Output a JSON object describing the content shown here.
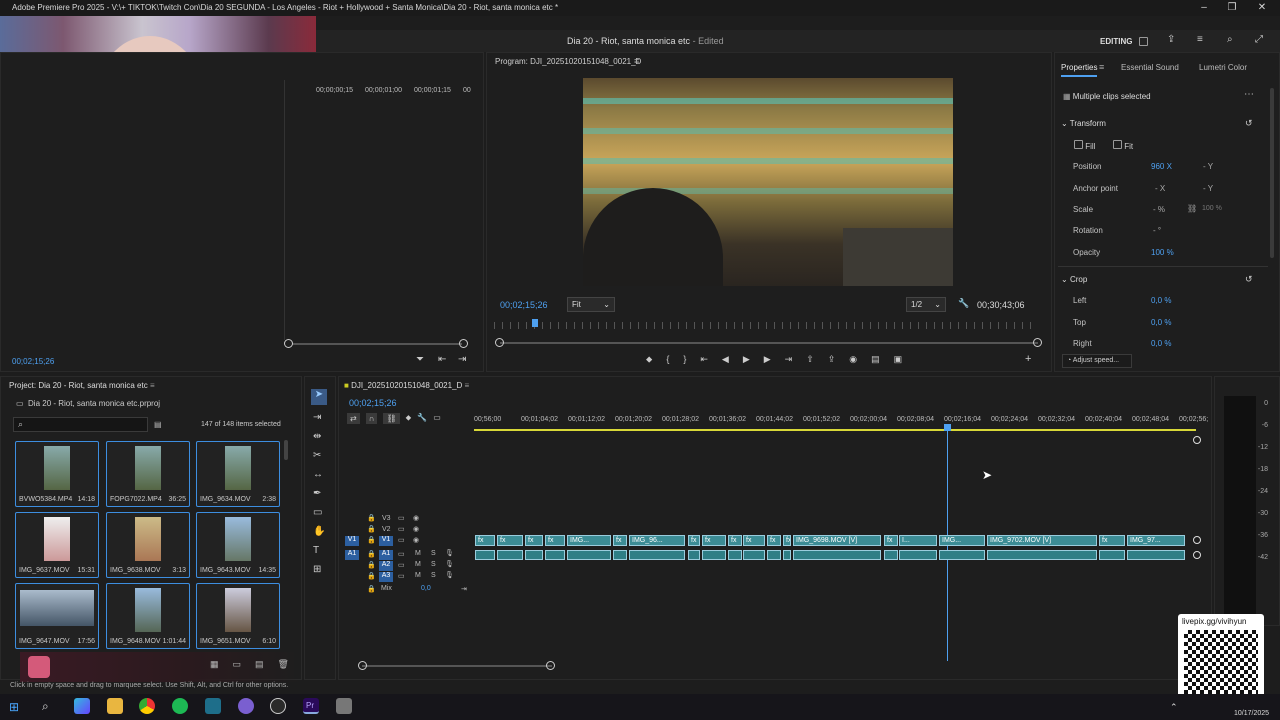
{
  "window": {
    "title": "Adobe Premiere Pro 2025 - V:\\+ TIKTOK\\Twitch Con\\Dia 20 SEGUNDA - Los Angeles - Riot + Hollywood + Santa Monica\\Dia 20 - Riot, santa monica etc *"
  },
  "header": {
    "doc_title": "Dia 20 - Riot, santa monica etc",
    "doc_status": "- Edited",
    "workspace": "EDITING"
  },
  "source": {
    "timecode": "00;02;15;26",
    "ruler": [
      "00;00;00;15",
      "00;00;01;00",
      "00;00;01;15",
      "00"
    ]
  },
  "program": {
    "label": "Program: DJI_20251020151048_0021_D",
    "timecode": "00;02;15;26",
    "fit": "Fit",
    "res": "1/2",
    "duration": "00;30;43;06"
  },
  "properties": {
    "tabs": [
      "Properties",
      "Essential Sound",
      "Lumetri Color"
    ],
    "selected": "Multiple clips selected",
    "transform": "Transform",
    "fill": "Fill",
    "fit": "Fit",
    "rows": [
      {
        "label": "Position",
        "v1": "960 X",
        "v2": "- Y"
      },
      {
        "label": "Anchor point",
        "v1": "- X",
        "v2": "- Y"
      },
      {
        "label": "Scale",
        "v1": "- %",
        "v2": "100 %"
      },
      {
        "label": "Rotation",
        "v1": "- °",
        "v2": ""
      },
      {
        "label": "Opacity",
        "v1": "100 %",
        "v2": ""
      }
    ],
    "crop": "Crop",
    "crop_rows": [
      {
        "label": "Left",
        "v": "0,0 %"
      },
      {
        "label": "Top",
        "v": "0,0 %"
      },
      {
        "label": "Right",
        "v": "0,0 %"
      }
    ],
    "adjust_speed": "Adjust speed..."
  },
  "project": {
    "label": "Project: Dia 20 - Riot, santa monica etc",
    "file": "Dia 20 - Riot, santa monica etc.prproj",
    "count": "147 of 148 items selected",
    "items": [
      {
        "name": "BVWO5384.MP4",
        "dur": "14:18"
      },
      {
        "name": "FOPG7022.MP4",
        "dur": "36:25"
      },
      {
        "name": "IMG_9634.MOV",
        "dur": "2:38"
      },
      {
        "name": "IMG_9637.MOV",
        "dur": "15:31"
      },
      {
        "name": "IMG_9638.MOV",
        "dur": "3:13"
      },
      {
        "name": "IMG_9643.MOV",
        "dur": "14:35"
      },
      {
        "name": "IMG_9647.MOV",
        "dur": "17:56"
      },
      {
        "name": "IMG_9648.MOV",
        "dur": "1:01:44"
      },
      {
        "name": "IMG_9651.MOV",
        "dur": "6:10"
      }
    ]
  },
  "timeline": {
    "seq": "DJI_20251020151048_0021_D",
    "timecode": "00;02;15;26",
    "ruler": [
      "00;56;00",
      "00;01;04;02",
      "00;01;12;02",
      "00;01;20;02",
      "00;01;28;02",
      "00;01;36;02",
      "00;01;44;02",
      "00;01;52;02",
      "00;02;00;04",
      "00;02;08;04",
      "00;02;16;04",
      "00;02;24;04",
      "00;02;32;04",
      "00;02;40;04",
      "00;02;48;04",
      "00;02;56;"
    ],
    "tracks_v": [
      "V3",
      "V2",
      "V1"
    ],
    "tracks_a": [
      "A1",
      "A2",
      "A3"
    ],
    "mix": "Mix",
    "mix_val": "0,0",
    "clips": [
      "IMG...",
      "IMG_96...",
      "IMG_9698.MOV [V]",
      "I...",
      "IMG...",
      "IMG_9702.MOV [V]",
      "IMG_97..."
    ]
  },
  "meter": {
    "labels": [
      "0",
      "-6",
      "-12",
      "-18",
      "-24",
      "-30",
      "-36",
      "-42"
    ]
  },
  "status": {
    "hint": "Click in empty space and drag to marquee select. Use Shift, Alt, and Ctrl for other options."
  },
  "overlay": {
    "qr_label": "livepix.gg/vivihyun"
  },
  "taskbar": {
    "date": "10/17/2025"
  }
}
